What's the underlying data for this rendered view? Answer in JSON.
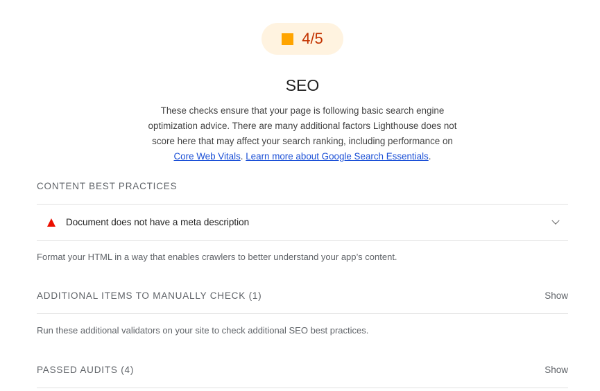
{
  "score": {
    "value": "4/5",
    "shape": "orange-square",
    "color": "#ffa400",
    "text_color": "#c33300",
    "background": "#fff3e0"
  },
  "category": {
    "title": "SEO",
    "description_text": "These checks ensure that your page is following basic search engine optimization advice. There are many additional factors Lighthouse does not score here that may affect your search ranking, including performance on",
    "link_core_web_vitals": "Core Web Vitals",
    "separator": ".",
    "link_learn_more": "Learn more about Google Search Essentials",
    "end_punct": "."
  },
  "groups": {
    "content_best_practices": {
      "title": "CONTENT BEST PRACTICES",
      "audit": {
        "title": "Document does not have a meta description",
        "status_icon": "fail-triangle-icon",
        "status_color": "#eb0f00"
      },
      "description": "Format your HTML in a way that enables crawlers to better understand your app’s content."
    },
    "manual": {
      "title": "ADDITIONAL ITEMS TO MANUALLY CHECK",
      "count": "(1)",
      "toggle_label": "Show",
      "description": "Run these additional validators on your site to check additional SEO best practices."
    },
    "passed": {
      "title": "PASSED AUDITS",
      "count": "(4)",
      "toggle_label": "Show"
    }
  }
}
